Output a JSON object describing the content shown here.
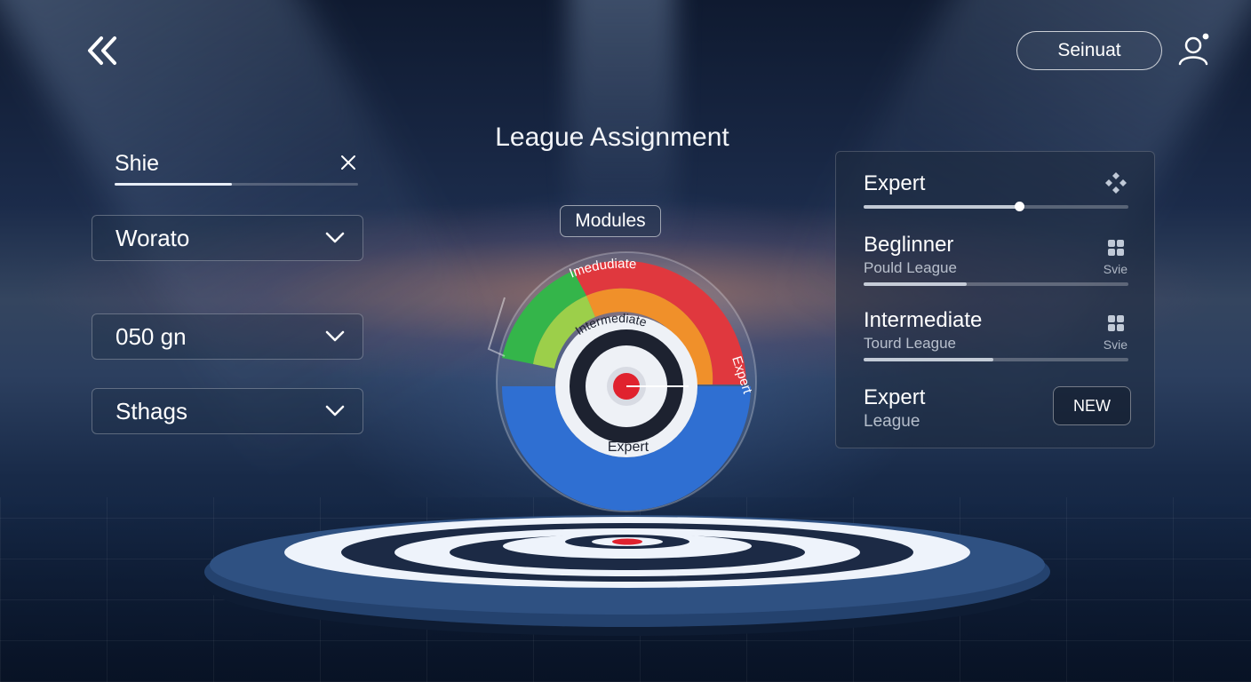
{
  "header": {
    "back_icon": "double-chevron-left-icon",
    "signin_label": "Seinuat",
    "user_icon": "user-icon"
  },
  "filters": {
    "search_value": "Shie",
    "search_progress": 0.48,
    "dropdowns": [
      {
        "label": "Worato"
      },
      {
        "label": "050 gn"
      },
      {
        "label": "Sthags"
      }
    ]
  },
  "main": {
    "title": "League Assignment",
    "modules_label": "Modules",
    "dial": {
      "top_arc_label": "Imedudiate",
      "right_arc_label": "Expert",
      "inner_arc_label": "Intermediate",
      "bottom_ring_label": "Expert",
      "colors": {
        "red": "#e0383e",
        "green": "#34b54a",
        "lime": "#9ccf4a",
        "orange": "#f0902a",
        "blue": "#2f6fd2"
      }
    }
  },
  "leagues": {
    "items": [
      {
        "title": "Expert",
        "progress": 0.59,
        "icon": "diamond-icon"
      },
      {
        "title": "Beglinner",
        "subtitle": "Pould League",
        "service": "Svie",
        "progress": 0.39,
        "icon": "grid-icon"
      },
      {
        "title": "Intermediate",
        "subtitle": "Tourd League",
        "service": "Svie",
        "progress": 0.49,
        "icon": "grid-icon"
      },
      {
        "title": "Expert",
        "subtitle": "League",
        "badge": "NEW"
      }
    ]
  }
}
